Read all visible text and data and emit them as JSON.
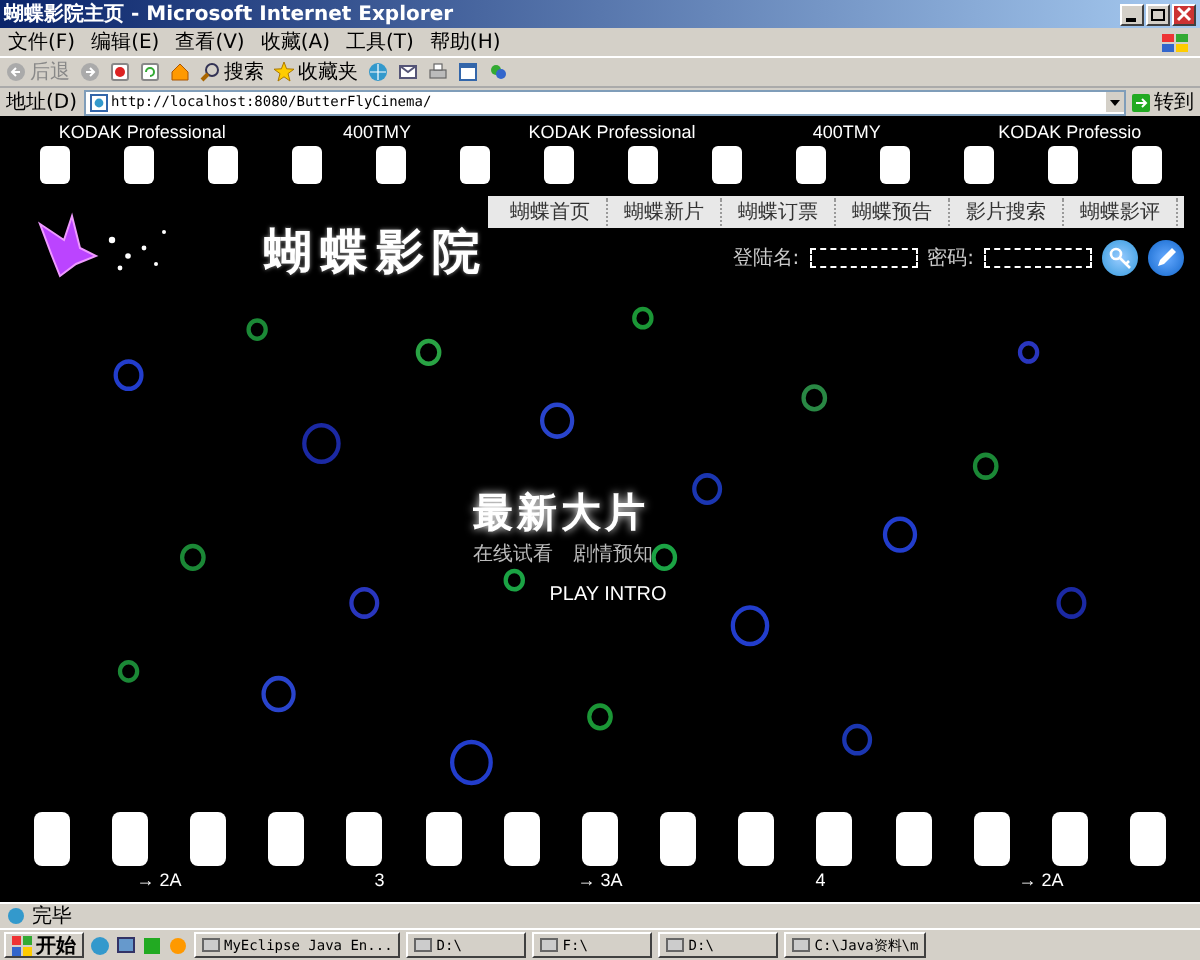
{
  "window": {
    "title": "蝴蝶影院主页 - Microsoft Internet Explorer"
  },
  "menu": [
    "文件(F)",
    "编辑(E)",
    "查看(V)",
    "收藏(A)",
    "工具(T)",
    "帮助(H)"
  ],
  "toolbar": [
    {
      "kind": "back",
      "label": "后退",
      "disabled": true
    },
    {
      "kind": "search",
      "label": "搜索",
      "disabled": false
    },
    {
      "kind": "favorites",
      "label": "收藏夹",
      "disabled": false
    }
  ],
  "address": {
    "label": "地址(D)",
    "url": "http://localhost:8080/ButterFlyCinema/",
    "go": "转到"
  },
  "film_top": {
    "labels": [
      "KODAK Professional",
      "400TMY",
      "KODAK Professional",
      "400TMY",
      "KODAK Professio"
    ]
  },
  "nav": [
    "蝴蝶首页",
    "蝴蝶新片",
    "蝴蝶订票",
    "蝴蝶预告",
    "影片搜索",
    "蝴蝶影评"
  ],
  "site_title": "蝴蝶影院",
  "login": {
    "user_label": "登陆名:",
    "password_label": "密码:"
  },
  "feature": {
    "title": "最新大片",
    "links": [
      "在线试看",
      "剧情预知"
    ],
    "play": "PLAY INTRO"
  },
  "film_bottom": {
    "labels": [
      "→ 2A",
      "3",
      "→ 3A",
      "4",
      "→ 2A"
    ]
  },
  "status_bar": {
    "text": "完毕"
  },
  "taskbar": {
    "start": "开始",
    "tasks": [
      "MyEclipse Java En...",
      "D:\\",
      "F:\\",
      "D:\\",
      "C:\\Java资料\\m"
    ]
  }
}
